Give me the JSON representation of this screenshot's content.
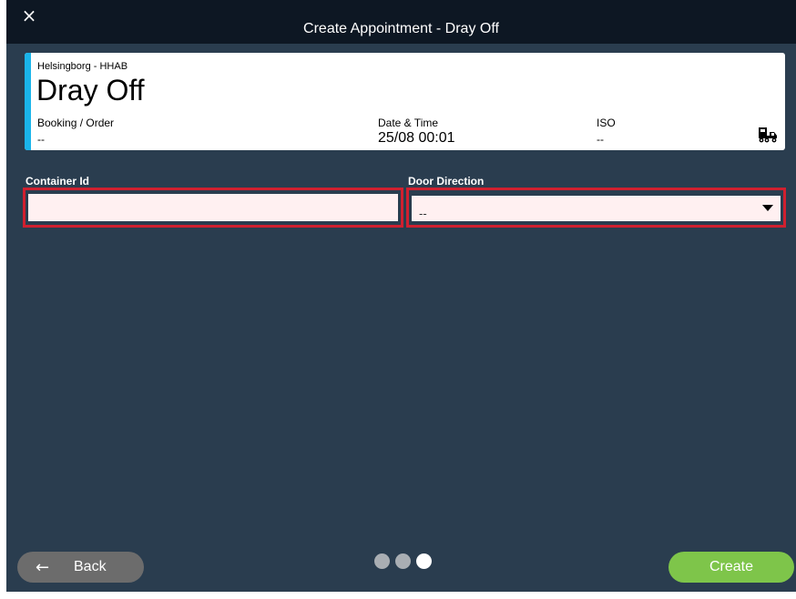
{
  "header": {
    "title": "Create Appointment - Dray Off",
    "close_label": "×"
  },
  "card": {
    "location": "Helsingborg - HHAB",
    "type": "Dray Off",
    "booking_label": "Booking / Order",
    "booking_value": "--",
    "datetime_label": "Date & Time",
    "datetime_value": "25/08 00:01",
    "iso_label": "ISO",
    "iso_value": "--",
    "icon": "truck-icon"
  },
  "form": {
    "container_id_label": "Container Id",
    "container_id_value": "",
    "door_direction_label": "Door Direction",
    "door_direction_value": "--"
  },
  "footer": {
    "back_label": "Back",
    "create_label": "Create",
    "steps_total": 3,
    "current_step": 3
  },
  "colors": {
    "accent": "#1ab4ea",
    "error_border": "#d0202f",
    "create": "#7ec54a",
    "back": "#6c6c6c"
  }
}
